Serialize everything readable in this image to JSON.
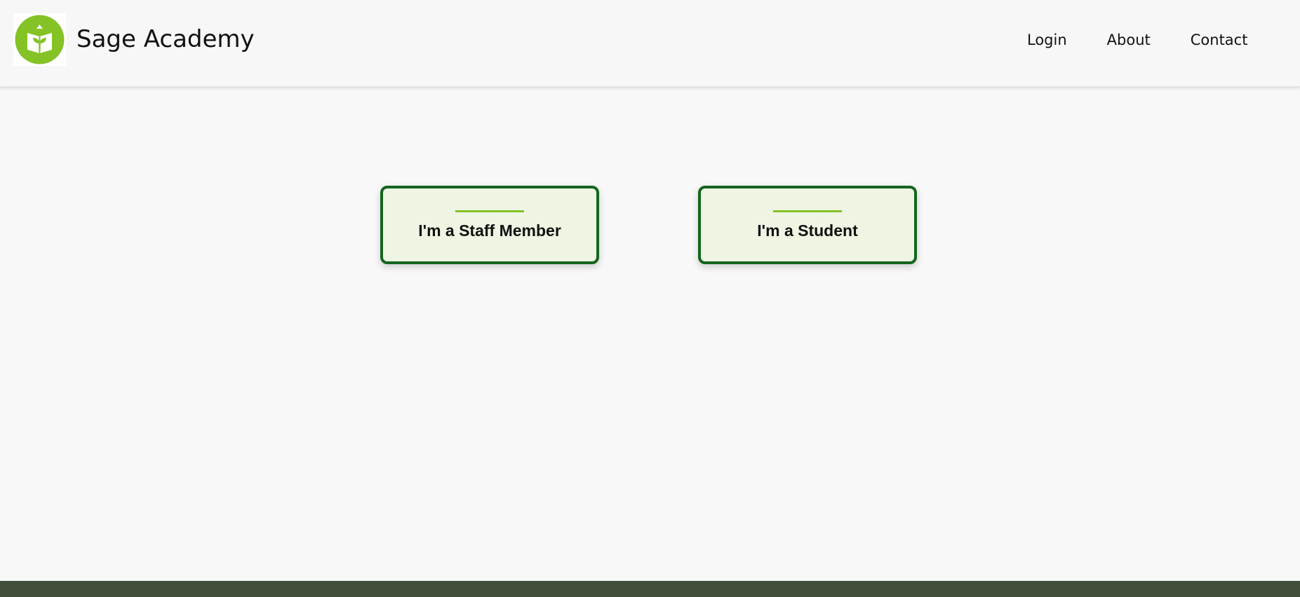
{
  "header": {
    "brand": "Sage Academy",
    "logo_icon": "book-sprout-logo-icon",
    "nav": [
      {
        "label": "Login"
      },
      {
        "label": "About"
      },
      {
        "label": "Contact"
      }
    ]
  },
  "main": {
    "cards": [
      {
        "label": "I'm a Staff Member"
      },
      {
        "label": "I'm a Student"
      }
    ]
  },
  "colors": {
    "brand_green": "#84c226",
    "card_border": "#14651e",
    "card_bg": "#eff5e3",
    "footer": "#40503a"
  }
}
